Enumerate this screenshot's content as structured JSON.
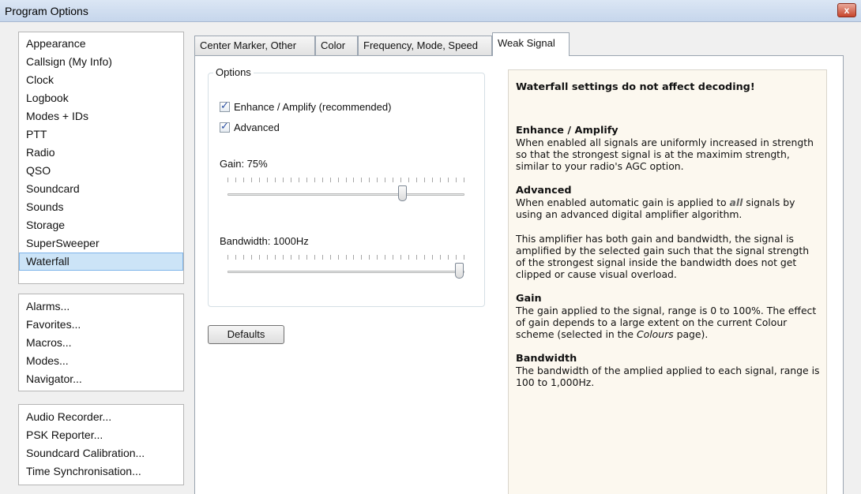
{
  "window": {
    "title": "Program Options",
    "close_glyph": "x"
  },
  "nav": {
    "group1": [
      "Appearance",
      "Callsign (My Info)",
      "Clock",
      "Logbook",
      "Modes + IDs",
      "PTT",
      "Radio",
      "QSO",
      "Soundcard",
      "Sounds",
      "Storage",
      "SuperSweeper",
      "Waterfall"
    ],
    "selected": "Waterfall",
    "group2": [
      "Alarms...",
      "Favorites...",
      "Macros...",
      "Modes...",
      "Navigator..."
    ],
    "group3": [
      "Audio Recorder...",
      "PSK Reporter...",
      "Soundcard Calibration...",
      "Time Synchronisation..."
    ]
  },
  "tabs": [
    "Center Marker, Other",
    "Color",
    "Frequency, Mode, Speed",
    "Weak Signal"
  ],
  "active_tab": "Weak Signal",
  "options": {
    "group_label": "Options",
    "enhance_label": "Enhance / Amplify (recommended)",
    "enhance_checked": true,
    "advanced_label": "Advanced",
    "advanced_checked": true,
    "gain_label": "Gain: 75%",
    "gain_fraction": 0.75,
    "bandwidth_label": "Bandwidth: 1000Hz",
    "bandwidth_fraction": 1.0,
    "defaults_button": "Defaults"
  },
  "info": {
    "warning": "Waterfall settings do not affect decoding!",
    "enhance_title": "Enhance / Amplify",
    "enhance_text": "When enabled all signals are uniformly increased in strength so that the strongest signal is at the maximim strength, similar to your radio's AGC option.",
    "advanced_title": "Advanced",
    "advanced_text_pre": "When enabled automatic gain is applied to ",
    "advanced_text_em": "all",
    "advanced_text_post": " signals by using an advanced digital amplifier algorithm.",
    "amplifier_text": "This amplifier has both gain and bandwidth, the signal is amplified by the selected gain such that the signal strength of the strongest signal inside the bandwidth does not get clipped or cause visual overload.",
    "gain_title": "Gain",
    "gain_text_pre": "The gain applied to the signal, range is 0 to 100%. The effect of gain depends to a large extent on the current Colour scheme (selected in the ",
    "gain_text_em": "Colours",
    "gain_text_post": " page).",
    "bandwidth_title": "Bandwidth",
    "bandwidth_text": "The bandwidth of the amplied applied to each signal, range is 100 to 1,000Hz."
  }
}
